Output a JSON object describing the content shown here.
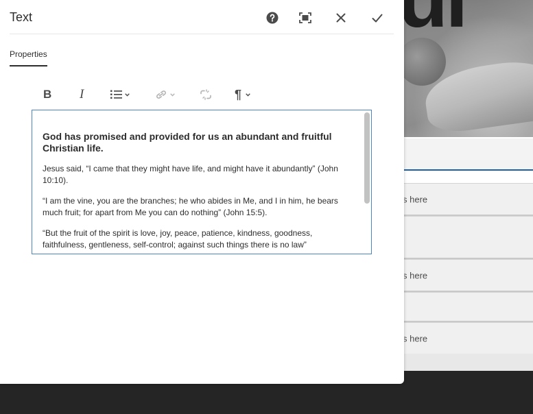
{
  "background": {
    "hero_text": "ui",
    "rows": [
      {
        "label": "s here",
        "selected": false
      },
      {
        "label": "s here",
        "selected": false
      },
      {
        "label": "s here",
        "selected": false
      }
    ]
  },
  "dialog": {
    "title": "Text",
    "header_buttons": {
      "help": "help-icon",
      "fullscreen": "fullscreen-icon",
      "close": "close-icon",
      "done": "checkmark-icon"
    },
    "tabs": [
      {
        "label": "Properties",
        "active": true
      }
    ],
    "toolbar": [
      {
        "name": "bold",
        "icon": "bold-icon",
        "glyph": "B"
      },
      {
        "name": "italic",
        "icon": "italic-icon",
        "glyph": "I"
      },
      {
        "name": "list",
        "icon": "list-icon"
      },
      {
        "name": "link",
        "icon": "link-icon"
      },
      {
        "name": "unlink",
        "icon": "unlink-icon"
      },
      {
        "name": "paragraph",
        "icon": "paragraph-icon",
        "glyph": "¶"
      }
    ],
    "editor": {
      "heading": "God has promised and provided for us an abundant and fruitful Christian life.",
      "paragraphs": [
        "Jesus said, “I came that they might have life, and might have it abundantly” (John 10:10).",
        "“I am the vine, you are the branches; he who abides in Me, and I in him, he bears much fruit; for apart from Me you can do nothing” (John 15:5).",
        "“But the fruit of the spirit is love, joy, peace, patience, kindness, goodness, faithfulness, gentleness, self-control; against such things there is no law”"
      ]
    }
  },
  "colors": {
    "accent": "#1f5fa8",
    "editor_border": "#4b83c5",
    "dark_footer": "#252525"
  }
}
